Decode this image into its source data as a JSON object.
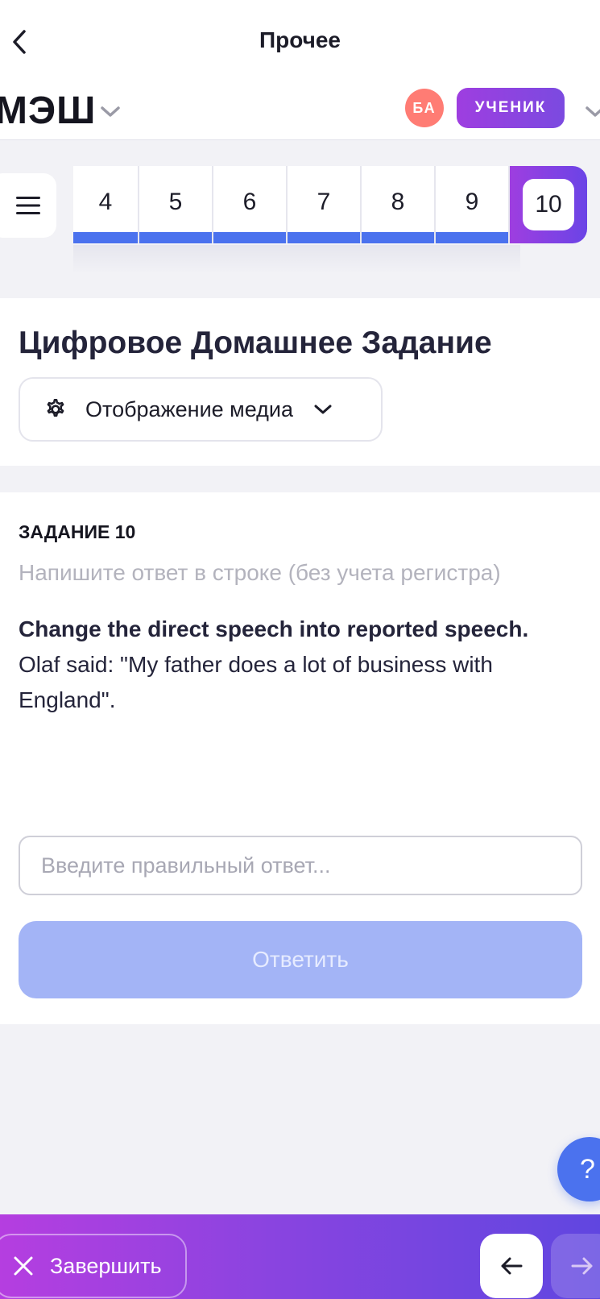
{
  "header": {
    "title": "Прочее"
  },
  "brand": {
    "logo_text": "МЭШ",
    "avatar_initials": "БА",
    "role": "УЧЕНИК"
  },
  "task_nav": {
    "items": [
      "4",
      "5",
      "6",
      "7",
      "8",
      "9"
    ],
    "current": "10",
    "progress_color": "#4b72ee"
  },
  "main": {
    "title": "Цифровое Домашнее Задание",
    "media_dropdown": "Отображение медиа"
  },
  "task": {
    "label": "ЗАДАНИЕ 10",
    "hint": "Напишите ответ в строке (без учета регистра)",
    "instruction": "Change the direct speech into reported speech.",
    "text": "Olaf said: \"My father does a lot of business with England\".",
    "input_placeholder": "Введите правильный ответ...",
    "submit_label": "Ответить"
  },
  "help": {
    "label": "?"
  },
  "footer": {
    "finish_label": "Завершить"
  },
  "colors": {
    "accent_purple": "#9e3ee0",
    "accent_blue": "#4b72ee",
    "avatar_red": "#ff7c74",
    "submit_disabled": "#a3b4f6"
  }
}
